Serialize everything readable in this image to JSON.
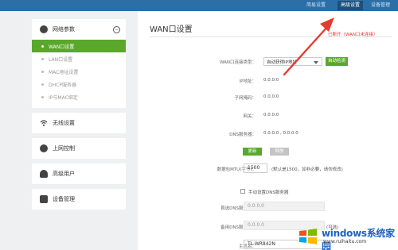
{
  "topbar": {
    "links": [
      "简易设置",
      "高级设置",
      "设备管理"
    ]
  },
  "sidebar": {
    "network": {
      "label": "网络参数",
      "items": [
        "WAN口设置",
        "LAN口设置",
        "MAC地址设置",
        "DHCP服务器",
        "IP与MAC绑定"
      ]
    },
    "wireless_label": "无线设置",
    "access_label": "上网控制",
    "user_label": "高级用户",
    "device_label": "设备管理"
  },
  "main": {
    "title": "WAN口设置",
    "status_note": "已断开（WAN口未连接）",
    "conn_type_label": "WAN口连接类型：",
    "conn_type_value": "自动获得IP地址",
    "auto_detect_label": "自动检测",
    "ip_label": "IP地址：",
    "ip_value": "0.0.0.0",
    "mask_label": "子网掩码：",
    "mask_value": "0.0.0.0",
    "gateway_label": "网关：",
    "gateway_value": "0.0.0.0",
    "dns_label": "DNS服务器：",
    "dns_value": "0.0.0.0 , 0.0.0.0",
    "renew_label": "更新",
    "release_label": "释放",
    "mtu_label": "数据包MTU(字节)：",
    "mtu_value": "1500",
    "mtu_hint": "(默认是1500，如非必要，请勿修改)",
    "manual_dns_label": "手动设置DNS服务器",
    "primary_dns_label": "首选DNS服务器：",
    "primary_dns_value": "0.0.0.0",
    "secondary_dns_label": "备用DNS服务器：",
    "secondary_dns_value": "0.0.0.0",
    "optional_label": "(可选)",
    "hostname_label": "主机名：",
    "hostname_value": "TL-WR842N"
  },
  "watermark": {
    "title": "windows系统家园",
    "sub": "www.ruihaitu.com"
  },
  "colors": {
    "topbar": "#2c6fa7",
    "accent_green": "#5aa82b",
    "arrow_red": "#e33b2e"
  }
}
